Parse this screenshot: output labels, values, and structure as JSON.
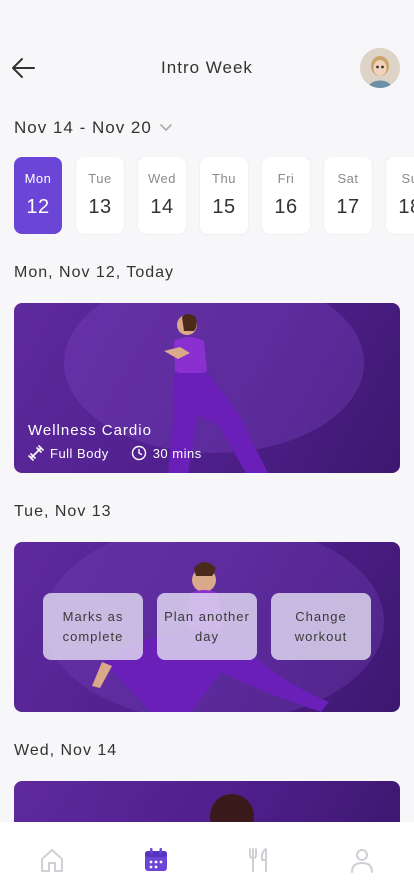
{
  "header": {
    "title": "Intro Week",
    "back_icon": "arrow-left-icon",
    "avatar_icon": "user-avatar"
  },
  "week": {
    "range": "Nov 14 - Nov 20",
    "days": [
      {
        "name": "Mon",
        "date": "12",
        "selected": true
      },
      {
        "name": "Tue",
        "date": "13",
        "selected": false
      },
      {
        "name": "Wed",
        "date": "14",
        "selected": false
      },
      {
        "name": "Thu",
        "date": "15",
        "selected": false
      },
      {
        "name": "Fri",
        "date": "16",
        "selected": false
      },
      {
        "name": "Sat",
        "date": "17",
        "selected": false
      },
      {
        "name": "Su",
        "date": "18",
        "selected": false
      }
    ]
  },
  "sections": [
    {
      "heading": "Mon, Nov 12, Today"
    },
    {
      "heading": "Tue, Nov 13"
    },
    {
      "heading": "Wed, Nov 14"
    }
  ],
  "cards": [
    {
      "title": "Wellness Cardio",
      "body": "Full Body",
      "duration": "30 mins"
    },
    {
      "actions": [
        "Marks as complete",
        "Plan another day",
        "Change workout"
      ]
    }
  ],
  "nav": {
    "items": [
      "home-icon",
      "calendar-icon",
      "fork-knife-icon",
      "user-icon"
    ],
    "active": "calendar-icon"
  },
  "colors": {
    "accent": "#6a45d6",
    "card": "#5a2a9a"
  }
}
